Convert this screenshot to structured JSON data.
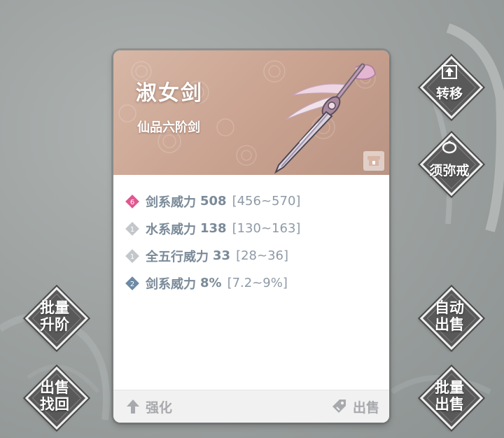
{
  "item": {
    "name": "淑女剑",
    "grade": "仙品六阶剑",
    "stats": [
      {
        "badge": "6",
        "badge_color": "#e0588f",
        "name": "剑系威力",
        "value": "508",
        "range": "[456~570]"
      },
      {
        "badge": "1",
        "badge_color": "#c4c7ca",
        "name": "水系威力",
        "value": "138",
        "range": "[130~163]"
      },
      {
        "badge": "1",
        "badge_color": "#c4c7ca",
        "name": "全五行威力",
        "value": "33",
        "range": "[28~36]"
      },
      {
        "badge": "2",
        "badge_color": "#6d8aa6",
        "name": "剑系威力",
        "value": "8%",
        "range": "[7.2~9%]"
      }
    ],
    "actions": {
      "strengthen_label": "强化",
      "sell_label": "出售"
    }
  },
  "side_buttons": {
    "transfer": "转移",
    "storage_ring": "须弥戒",
    "batch_upgrade": "批量\n升阶",
    "auto_sell": "自动\n出售",
    "sold_retrieve": "出售\n找回",
    "batch_sell": "批量\n出售"
  },
  "colors": {
    "header_bg": "#c9a18f",
    "stat_text": "#7a8a98",
    "button_dark": "#595959"
  },
  "icons": [
    "upload-icon",
    "ring-icon",
    "lock-icon",
    "arrow-up-icon",
    "sell-tag-icon",
    "sword-icon"
  ]
}
